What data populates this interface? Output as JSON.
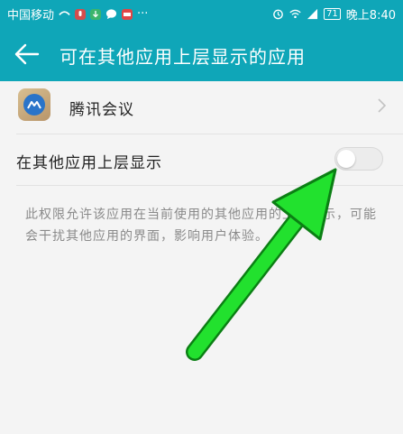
{
  "status_bar": {
    "carrier": "中国移动",
    "more": "···",
    "battery": "71",
    "time": "晚上8:40"
  },
  "toolbar": {
    "title": "可在其他应用上层显示的应用"
  },
  "app": {
    "name": "腾讯会议"
  },
  "setting": {
    "label": "在其他应用上层显示",
    "enabled": false
  },
  "description": {
    "text": "此权限允许该应用在当前使用的其他应用的上层显示，可能会干扰其他应用的界面，影响用户体验。"
  },
  "colors": {
    "accent": "#0fa6b8",
    "arrow": "#22e12e",
    "arrow_outline": "#0b7f14"
  }
}
